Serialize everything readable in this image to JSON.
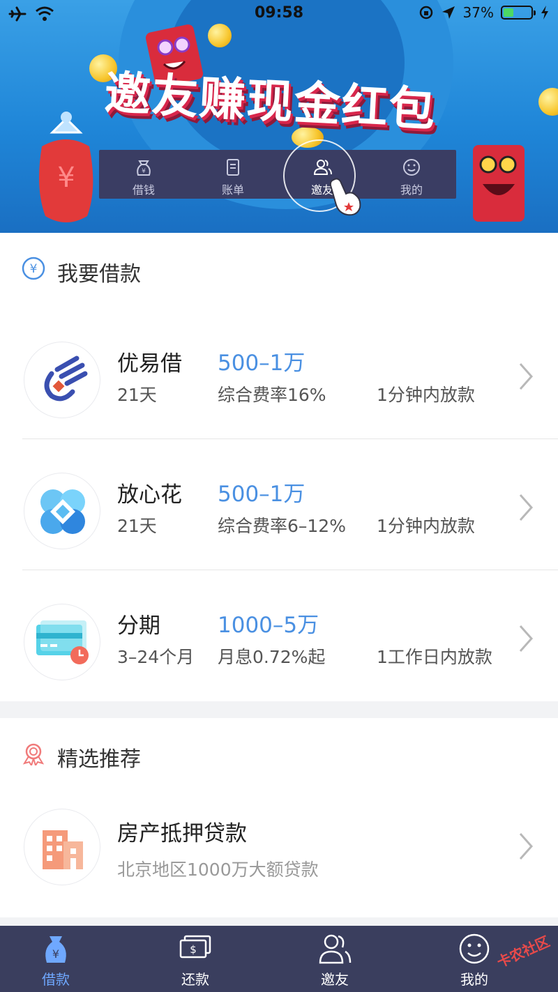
{
  "status_bar": {
    "time": "09:58",
    "battery": "37%",
    "battery_level": 0.37
  },
  "banner": {
    "headline": "邀友赚现金红包",
    "tabs": [
      {
        "label": "借钱",
        "icon": "money-bag-icon"
      },
      {
        "label": "账单",
        "icon": "bill-icon"
      },
      {
        "label": "邀友",
        "icon": "friends-icon",
        "active": true
      },
      {
        "label": "我的",
        "icon": "smile-icon"
      }
    ]
  },
  "loan_section": {
    "title": "我要借款",
    "icon": "yuan-circle-icon",
    "products": [
      {
        "name": "优易借",
        "amount": "500–1万",
        "term": "21天",
        "rate": "综合费率16%",
        "speed": "1分钟内放款",
        "icon": "comet-logo-icon"
      },
      {
        "name": "放心花",
        "amount": "500–1万",
        "term": "21天",
        "rate": "综合费率6–12%",
        "speed": "1分钟内放款",
        "icon": "blossom-logo-icon"
      },
      {
        "name": "分期",
        "amount": "1000–5万",
        "term": "3–24个月",
        "rate": "月息0.72%起",
        "speed": "1工作日内放款",
        "icon": "card-clock-icon"
      }
    ]
  },
  "recommend_section": {
    "title": "精选推荐",
    "icon": "award-ribbon-icon",
    "items": [
      {
        "name": "房产抵押贷款",
        "sub": "北京地区1000万大额贷款",
        "icon": "building-icon"
      }
    ]
  },
  "tab_bar": [
    {
      "label": "借款",
      "icon": "money-bag-icon",
      "active": true
    },
    {
      "label": "还款",
      "icon": "cash-icon"
    },
    {
      "label": "邀友",
      "icon": "friends-icon"
    },
    {
      "label": "我的",
      "icon": "smile-icon"
    }
  ],
  "watermark": "卡农社区",
  "colors": {
    "accent": "#4a90e2",
    "tabbar": "#3a3e5e",
    "active_tab": "#6fa8ff",
    "banner_blue": "#1f86d8"
  }
}
